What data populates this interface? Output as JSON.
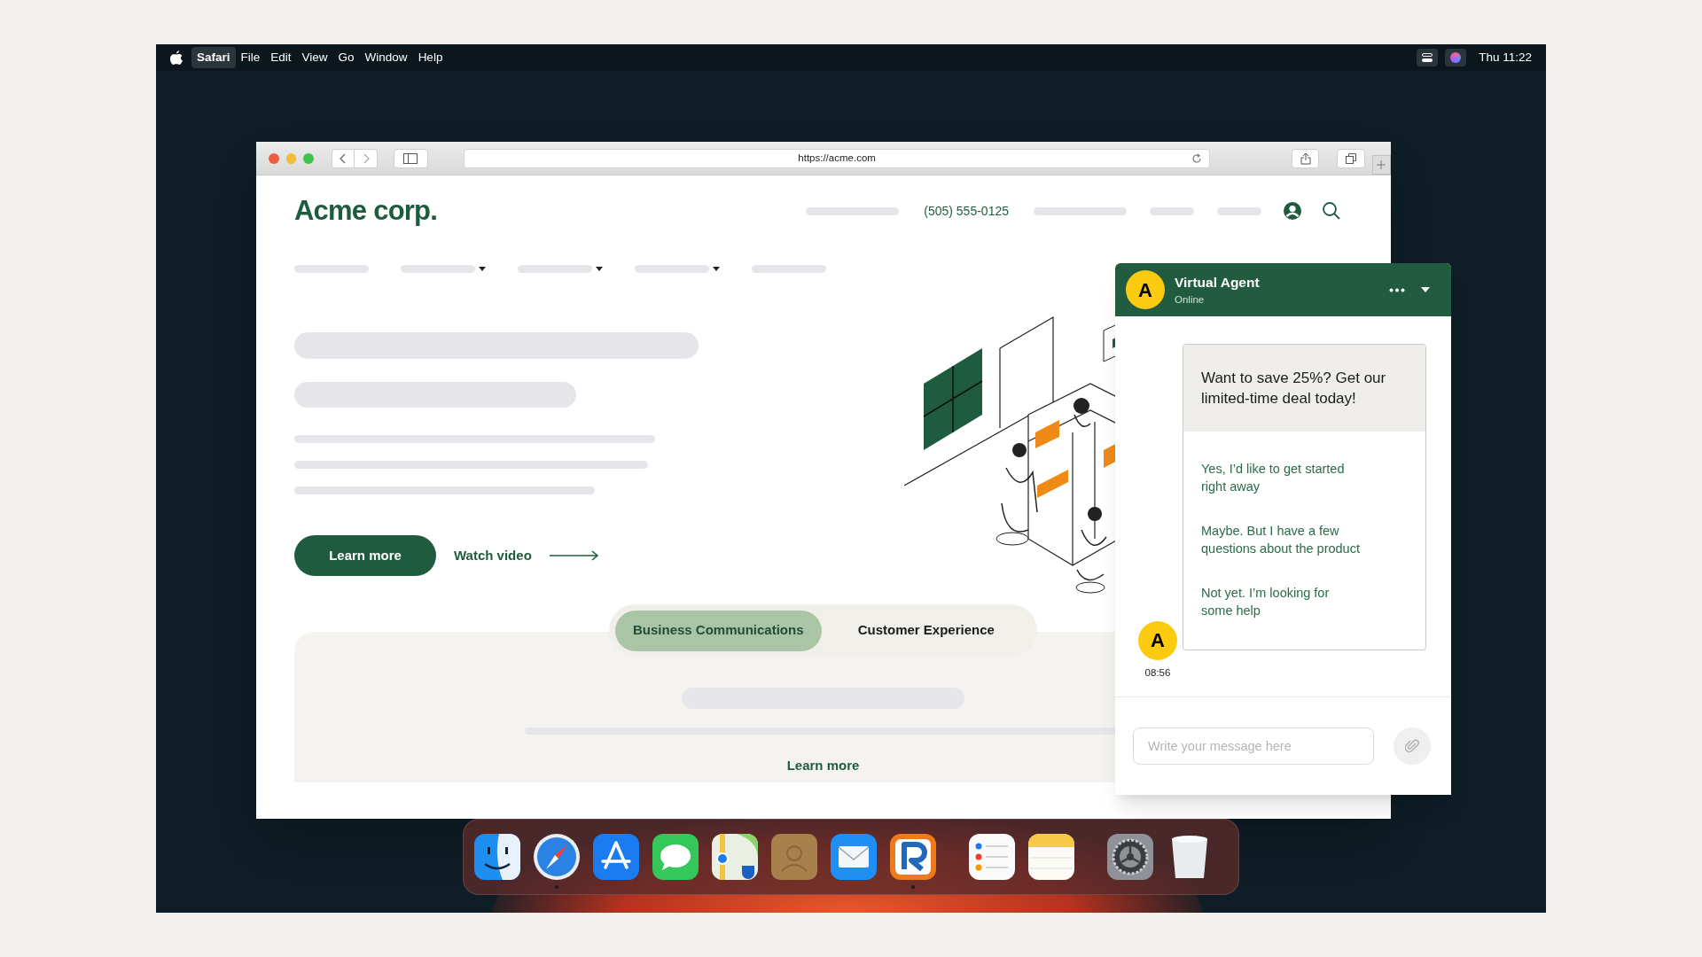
{
  "menu_bar": {
    "menus": [
      {
        "label": "Safari",
        "kind": "app",
        "selected": true
      },
      {
        "label": "File",
        "kind": "menu",
        "selected": false
      },
      {
        "label": "Edit",
        "kind": "menu",
        "selected": false
      },
      {
        "label": "View",
        "kind": "menu",
        "selected": false
      },
      {
        "label": "Go",
        "kind": "menu",
        "selected": false
      },
      {
        "label": "Window",
        "kind": "menu",
        "selected": false
      },
      {
        "label": "Help",
        "kind": "menu",
        "selected": false
      }
    ],
    "clock": "Thu 11:22"
  },
  "browser": {
    "url": "https://acme.com"
  },
  "site": {
    "logo": "Acme corp.",
    "phone": "(505) 555-0125",
    "nav": [
      {
        "has_menu": false
      },
      {
        "has_menu": true
      },
      {
        "has_menu": true
      },
      {
        "has_menu": true
      },
      {
        "has_menu": false
      }
    ],
    "hero": {
      "primary_button": "Learn more",
      "secondary_link": "Watch video"
    },
    "tabs": [
      {
        "label": "Business Communications",
        "selected": true
      },
      {
        "label": "Customer Experience",
        "selected": false
      }
    ],
    "panel_link": "Learn more"
  },
  "chat": {
    "agent_initial": "A",
    "agent_name": "Virtual Agent",
    "status": "Online",
    "message": "Want to save 25%? Get our limited-time deal today!",
    "options": [
      "Yes, I’d like to get started right away",
      "Maybe. But I have a few questions about the product",
      "Not yet. I’m looking for some help"
    ],
    "avatar_initial": "A",
    "time": "08:56",
    "input": {
      "placeholder": "Write your message here"
    }
  },
  "dock": [
    {
      "kind": "finder",
      "running": false
    },
    {
      "kind": "compass",
      "running": true
    },
    {
      "kind": "appstore",
      "running": false
    },
    {
      "kind": "messages",
      "running": false
    },
    {
      "kind": "maps",
      "running": false
    },
    {
      "kind": "contacts",
      "running": false
    },
    {
      "kind": "mail",
      "running": false
    },
    {
      "kind": "rapp",
      "running": true
    },
    {
      "kind": "reminders",
      "running": false
    },
    {
      "kind": "notes",
      "running": false
    },
    {
      "kind": "settings",
      "running": false
    },
    {
      "kind": "trash",
      "running": false
    }
  ]
}
